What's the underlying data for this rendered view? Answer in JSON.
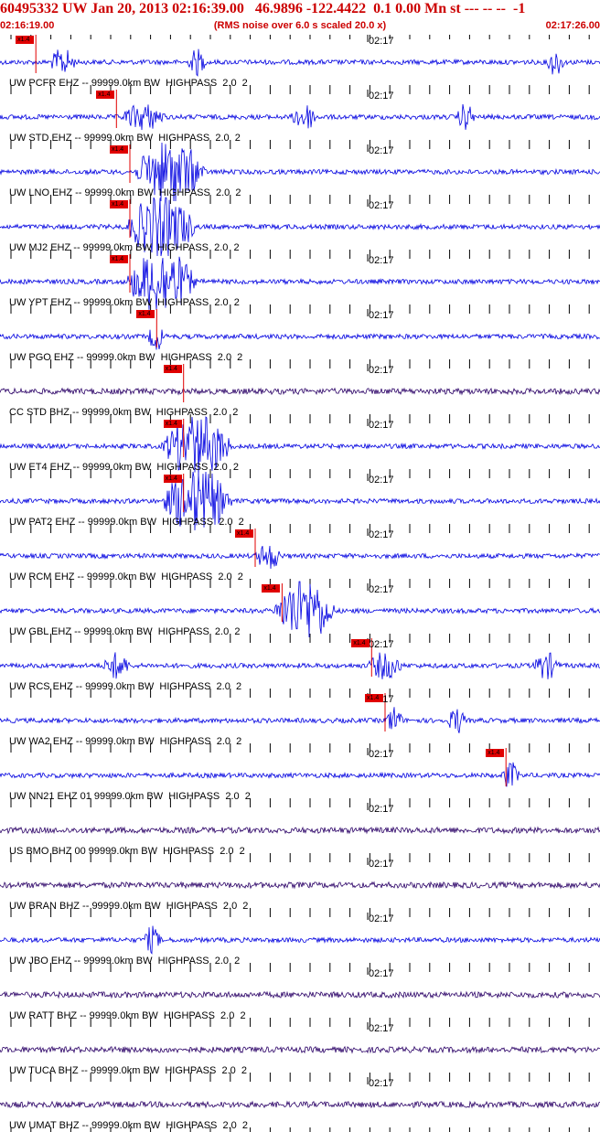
{
  "header": {
    "title": "60495332 UW Jan 20, 2013 02:16:39.00   46.9896 -122.4422  0.1 0.00 Mn st --- -- --  -1",
    "start_time": "02:16:19.00",
    "note": "(RMS noise over 6.0 s scaled 20.0 x)",
    "end_time": "02:17:26.00"
  },
  "colors": {
    "header": "#cc0000",
    "trace": "#0000e0",
    "trace_bh": "#2a0066",
    "pick": "#e00000"
  },
  "chart_data": {
    "type": "line",
    "description_type": "seismogram",
    "x_range": [
      "02:16:19.00",
      "02:17:26.00"
    ],
    "tick_mark": "02:17",
    "series": [
      {
        "name": "UW PCFR EHZ -- 99999.0km BW  HIGHPASS  2.0  2",
        "pick": "x1.4",
        "pick_time": 4,
        "events": [
          [
            7,
            3
          ],
          [
            22,
            2
          ],
          [
            62,
            2
          ]
        ],
        "color": "trace"
      },
      {
        "name": "UW STD EHZ -- 99999.0km BW  HIGHPASS  2.0  2",
        "pick": "x1.4",
        "pick_time": 13,
        "events": [
          [
            16,
            5
          ],
          [
            34,
            3
          ],
          [
            52,
            2
          ]
        ],
        "color": "trace"
      },
      {
        "name": "UW LNO EHZ -- 99999.0km BW  HIGHPASS  2.0  2",
        "pick": "x1.4",
        "pick_time": 14.5,
        "events": [
          [
            19,
            8
          ]
        ],
        "color": "trace"
      },
      {
        "name": "UW MJ2 EHZ -- 99999.0km BW  HIGHPASS  2.0  2",
        "pick": "x1.4",
        "pick_time": 14.5,
        "events": [
          [
            18,
            8
          ]
        ],
        "color": "trace"
      },
      {
        "name": "UW YPT EHZ -- 99999.0km BW  HIGHPASS  2.0  2",
        "pick": "x1.4",
        "pick_time": 14.5,
        "events": [
          [
            18,
            8
          ]
        ],
        "color": "trace"
      },
      {
        "name": "UW PGO EHZ -- 99999.0km BW  HIGHPASS  2.0  2",
        "pick": "x1.4",
        "pick_time": 17.5,
        "events": [
          [
            17.5,
            2
          ]
        ],
        "color": "trace"
      },
      {
        "name": "CC STD BHZ -- 99999.0km BW  HIGHPASS  2.0  2",
        "pick": "x1.4",
        "pick_time": 20.5,
        "events": [],
        "color": "trace_bh"
      },
      {
        "name": "UW ET4 EHZ -- 99999.0km BW  HIGHPASS  2.0  2",
        "pick": "x1.4",
        "pick_time": 20.5,
        "events": [
          [
            22,
            8
          ]
        ],
        "color": "trace"
      },
      {
        "name": "UW PAT2 EHZ -- 99999.0km BW  HIGHPASS  2.0  2",
        "pick": "x1.4",
        "pick_time": 20.5,
        "events": [
          [
            22,
            8
          ]
        ],
        "color": "trace"
      },
      {
        "name": "UW RCM EHZ -- 99999.0km BW  HIGHPASS  2.0  2",
        "pick": "x1.4",
        "pick_time": 28.5,
        "events": [
          [
            30,
            3
          ]
        ],
        "color": "trace"
      },
      {
        "name": "UW GBL EHZ -- 99999.0km BW  HIGHPASS  2.0  2",
        "pick": "x1.4",
        "pick_time": 31.5,
        "events": [
          [
            34,
            7
          ]
        ],
        "color": "trace"
      },
      {
        "name": "UW RCS EHZ -- 99999.0km BW  HIGHPASS  2.0  2",
        "pick": "x1.4",
        "pick_time": 41.5,
        "events": [
          [
            43,
            4
          ],
          [
            13,
            3
          ],
          [
            61,
            3
          ]
        ],
        "color": "trace"
      },
      {
        "name": "UW WA2 EHZ -- 99999.0km BW  HIGHPASS  2.0  2",
        "pick": "x1.4",
        "pick_time": 43,
        "events": [
          [
            44,
            2
          ],
          [
            51,
            2
          ]
        ],
        "color": "trace"
      },
      {
        "name": "UW NN21 EHZ 01 99999.0km BW  HIGHPASS  2.0  2",
        "pick": "x1.4",
        "pick_time": 56.5,
        "events": [
          [
            57,
            2
          ]
        ],
        "color": "trace"
      },
      {
        "name": "US BMO BHZ 00 99999.0km BW  HIGHPASS  2.0  2",
        "pick": "",
        "pick_time": null,
        "events": [],
        "color": "trace_bh"
      },
      {
        "name": "UW BRAN BHZ -- 99999.0km BW  HIGHPASS  2.0  2",
        "pick": "",
        "pick_time": null,
        "events": [],
        "color": "trace_bh"
      },
      {
        "name": "UW JBO EHZ -- 99999.0km BW  HIGHPASS  2.0  2",
        "pick": "",
        "pick_time": null,
        "events": [
          [
            17,
            2
          ]
        ],
        "color": "trace"
      },
      {
        "name": "UW RATT BHZ -- 99999.0km BW  HIGHPASS  2.0  2",
        "pick": "",
        "pick_time": null,
        "events": [],
        "color": "trace_bh"
      },
      {
        "name": "UW TUCA BHZ -- 99999.0km BW  HIGHPASS  2.0  2",
        "pick": "",
        "pick_time": null,
        "events": [],
        "color": "trace_bh"
      },
      {
        "name": "UW UMAT BHZ -- 99999.0km BW  HIGHPASS  2.0  2",
        "pick": "",
        "pick_time": null,
        "events": [],
        "color": "trace_bh"
      }
    ]
  }
}
